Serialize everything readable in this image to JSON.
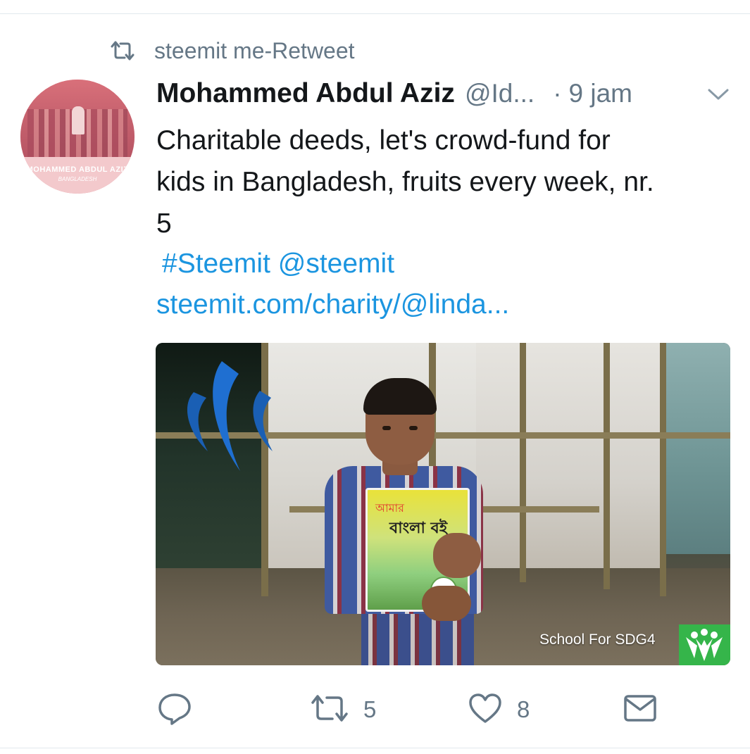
{
  "retweet": {
    "icon": "retweet-icon",
    "text": "steemit me-Retweet"
  },
  "avatar": {
    "name_text": "MOHAMMED ABDUL AZIZ",
    "country_text": "BANGLADESH"
  },
  "tweet": {
    "display_name": "Mohammed Abdul Aziz",
    "handle": "@Id...",
    "separator": "·",
    "time": "9 jam",
    "body_lines": [
      "Charitable deeds, let's crowd-fund for",
      "kids in Bangladesh, fruits every week, nr.",
      "5"
    ],
    "hashtag": "#Steemit",
    "mention": "@steemit",
    "link": "steemit.com/charity/@linda..."
  },
  "media": {
    "book_title_line1": "আমার",
    "book_title_line2": "বাংলা বই",
    "watermark_text": "School For SDG4",
    "logo_color": "#35b54a",
    "steem_color": "#1a5fb4"
  },
  "actions": {
    "reply": {
      "icon": "reply-icon"
    },
    "retweet": {
      "icon": "retweet-icon",
      "count": "5"
    },
    "like": {
      "icon": "heart-icon",
      "count": "8"
    },
    "message": {
      "icon": "envelope-icon"
    }
  },
  "colors": {
    "link": "#1b95e0",
    "muted": "#657786",
    "text": "#14171a"
  }
}
